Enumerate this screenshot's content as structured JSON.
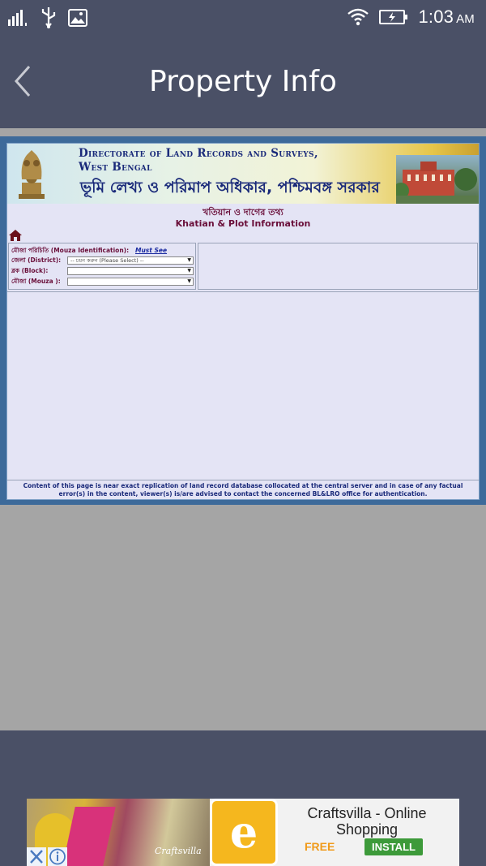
{
  "status_bar": {
    "time": "1:03",
    "ampm": "AM",
    "icons": [
      "signal-icon",
      "usb-icon",
      "image-icon",
      "wifi-icon",
      "battery-charging-icon"
    ]
  },
  "app_bar": {
    "title": "Property Info",
    "back_icon": "chevron-left-icon"
  },
  "web": {
    "banner": {
      "line1": "Directorate of Land Records and Surveys,",
      "line2": "West Bengal",
      "bengali": "ভূমি লেখ্য ও পরিমাপ অধিকার, পশ্চিমবঙ্গ সরকার"
    },
    "heading_bn": "খতিয়ান ও দাগের তথ্য",
    "heading_en": "Khatian & Plot Information",
    "form": {
      "mouza_identification": "মৌজা পরিচিতি (Mouza Identification):",
      "must_see": "Must See",
      "district_label": "জেলা (District):",
      "district_value": "-- চয়ন করুন (Please Select) --",
      "block_label": "ব্লক (Block):",
      "block_value": "",
      "mouza_label": "মৌজা (Mouza ):",
      "mouza_value": ""
    },
    "footer_note": "Content of this page is near exact replication of land record database collocated at the central server and in case of any factual error(s) in the content, viewer(s) is/are advised to contact the concerned BL&LRO office for authentication."
  },
  "ad": {
    "brand_text": "Craftsvilla",
    "logo_letter": "e",
    "name": "Craftsvilla - Online Shopping",
    "price": "FREE",
    "install_label": "INSTALL",
    "colors": {
      "logo": "#f5b71e",
      "install": "#3d9a3a",
      "free": "#f09a1a"
    }
  },
  "colors": {
    "app_bar": "#4a5066",
    "content_bg": "#a5a5a5",
    "web_frame": "#3d6a9a",
    "web_bg": "#e4e4f5",
    "heading": "#6a0f3a",
    "banner_text": "#1a2a7a"
  }
}
